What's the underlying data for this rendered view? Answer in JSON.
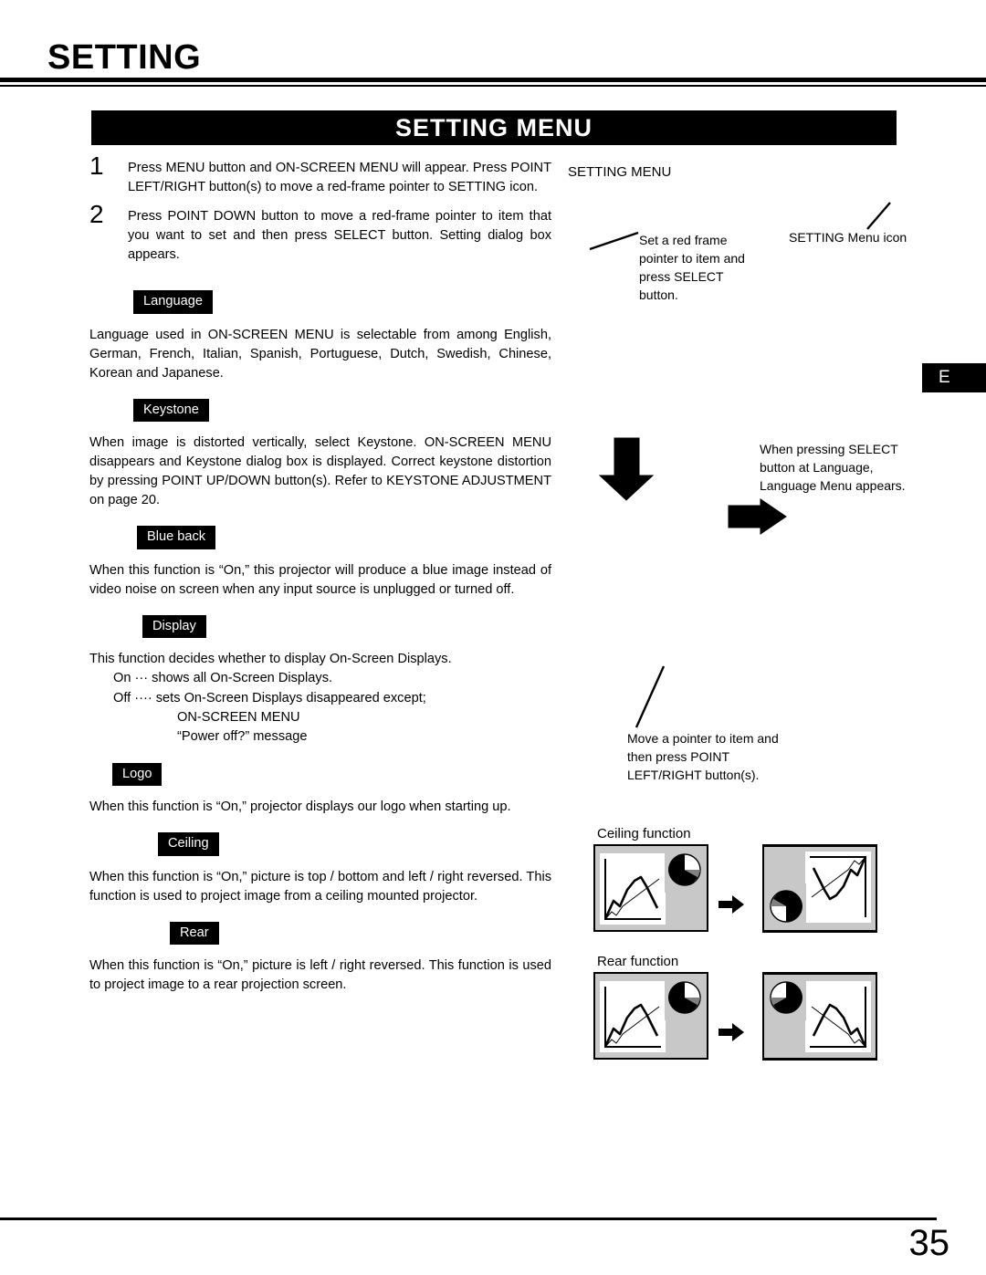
{
  "header": {
    "chapter_title": "SETTING",
    "banner_title": "SETTING MENU"
  },
  "edge_marker": {
    "label": "E"
  },
  "footer": {
    "page_number": "35"
  },
  "steps": [
    {
      "number": "1",
      "text": "Press MENU button and ON-SCREEN MENU will appear.  Press POINT LEFT/RIGHT button(s) to move a red-frame pointer to SETTING icon."
    },
    {
      "number": "2",
      "text": "Press POINT DOWN button to move a red-frame pointer to item that you want to set and then press SELECT button.  Setting dialog box appears."
    }
  ],
  "sections": [
    {
      "tag": "Language",
      "text": "Language used in ON-SCREEN MENU is selectable from among English, German, French, Italian, Spanish, Portuguese, Dutch, Swedish, Chinese, Korean and Japanese."
    },
    {
      "tag": "Keystone",
      "text": "When image is distorted vertically, select Keystone.  ON-SCREEN MENU disappears and Keystone dialog box is displayed.  Correct keystone distortion by pressing POINT UP/DOWN button(s).   Refer to KEYSTONE ADJUSTMENT on page 20."
    },
    {
      "tag": "Blue back",
      "text": "When this function is “On,” this projector will produce a blue image instead of video noise on screen when any input source is unplugged or turned off."
    },
    {
      "tag": "Display",
      "text": "This function decides whether to display On-Screen Displays.",
      "sub_lines": [
        "On  ···  shows all On-Screen Displays.",
        "Off ···· sets On-Screen Displays disappeared except;"
      ],
      "sub_lines_2": [
        "ON-SCREEN MENU",
        "“Power off?” message"
      ]
    },
    {
      "tag": "Logo",
      "text": "When this function is “On,” projector displays our logo when starting up."
    },
    {
      "tag": "Ceiling",
      "text": "When this function is “On,” picture is top / bottom and left / right reversed.  This function is used to project image from a ceiling mounted projector."
    },
    {
      "tag": "Rear",
      "text": "When this function is “On,” picture is left / right reversed.  This function is used to project image to a rear projection screen."
    }
  ],
  "annotations": {
    "setting_menu_caption": "SETTING MENU",
    "set_red_frame": "Set a red frame\npointer to item and\npress SELECT\nbutton.",
    "setting_menu_icon": "SETTING Menu icon",
    "select_language": "When pressing SELECT\nbutton at Language,\nLanguage Menu appears.",
    "move_pointer": "Move a pointer to item and\nthen press POINT\nLEFT/RIGHT button(s)."
  },
  "diagrams": {
    "ceiling_label": "Ceiling function",
    "rear_label": "Rear function"
  },
  "colors": {
    "ink": "#000000",
    "paper": "#ffffff",
    "diagram_gray": "#c8c8c8",
    "diagram_dark_gray": "#808080"
  }
}
